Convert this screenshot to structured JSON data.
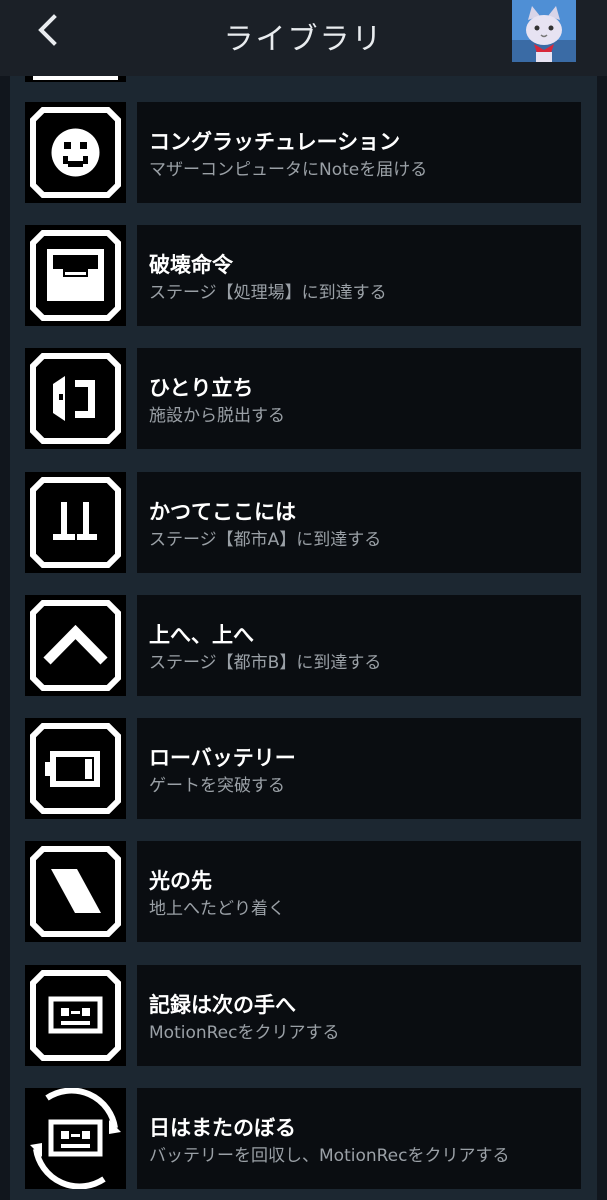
{
  "header": {
    "title": "ライブラリ",
    "back_icon": "chevron-left-icon",
    "avatar_icon": "cat-avatar-icon"
  },
  "colors": {
    "background": "#11161d",
    "header": "#1b2027",
    "frame": "#1c2731",
    "card": "#0a0d11",
    "title_text": "#ffffff",
    "subtitle_text": "#9aa0a6"
  },
  "achievements": [
    {
      "title": "コングラッチュレーション",
      "description": "マザーコンピュータにNoteを届ける",
      "icon": "smiley-face-icon"
    },
    {
      "title": "破壊命令",
      "description": "ステージ【処理場】に到達する",
      "icon": "crusher-icon"
    },
    {
      "title": "ひとり立ち",
      "description": "施設から脱出する",
      "icon": "door-exit-icon"
    },
    {
      "title": "かつてここには",
      "description": "ステージ【都市A】に到達する",
      "icon": "city-ruins-icon"
    },
    {
      "title": "上へ、上へ",
      "description": "ステージ【都市B】に到達する",
      "icon": "chevron-up-icon"
    },
    {
      "title": "ローバッテリー",
      "description": "ゲートを突破する",
      "icon": "low-battery-icon"
    },
    {
      "title": "光の先",
      "description": "地上へたどり着く",
      "icon": "light-beam-icon"
    },
    {
      "title": "記録は次の手へ",
      "description": "MotionRecをクリアする",
      "icon": "cassette-tape-icon"
    },
    {
      "title": "日はまたのぼる",
      "description": "バッテリーを回収し、MotionRecをクリアする",
      "icon": "cassette-cycle-icon"
    }
  ]
}
